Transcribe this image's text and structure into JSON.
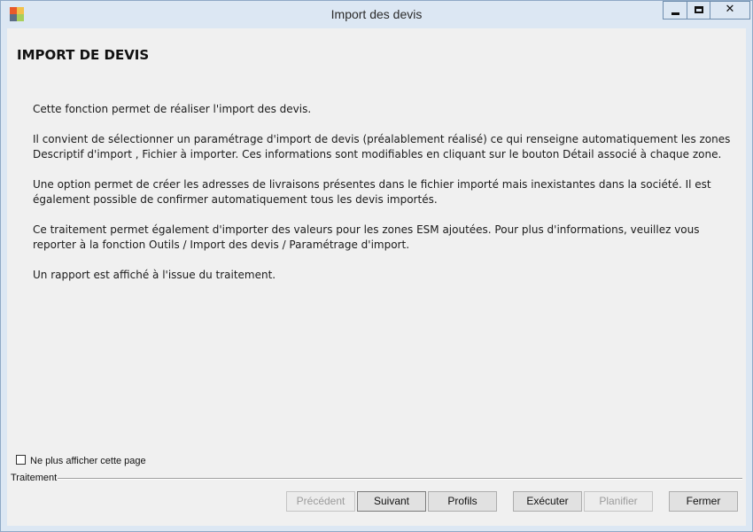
{
  "window": {
    "title": "Import des devis"
  },
  "page": {
    "title": "IMPORT DE DEVIS",
    "paragraphs": [
      "Cette fonction permet de réaliser l'import des devis.",
      "Il convient de sélectionner un paramétrage d'import de devis (préalablement réalisé) ce qui renseigne automatiquement les zones Descriptif d'import , Fichier à importer. Ces informations sont modifiables en cliquant sur le bouton Détail associé à chaque zone.",
      "Une option permet de créer les adresses de livraisons présentes dans le fichier importé mais inexistantes dans la société. Il est également possible de confirmer automatiquement tous les devis importés.",
      "Ce traitement permet également d'importer des valeurs pour les zones ESM ajoutées. Pour plus d'informations, veuillez vous reporter à la fonction Outils / Import des devis / Paramétrage d'import.",
      "Un rapport est affiché à l'issue du traitement."
    ]
  },
  "options": {
    "dont_show_label": "Ne plus afficher cette page",
    "dont_show_checked": false
  },
  "group": {
    "label": "Traitement"
  },
  "buttons": {
    "precedent": "Précédent",
    "suivant": "Suivant",
    "profils": "Profils",
    "executer": "Exécuter",
    "planifier": "Planifier",
    "fermer": "Fermer"
  }
}
